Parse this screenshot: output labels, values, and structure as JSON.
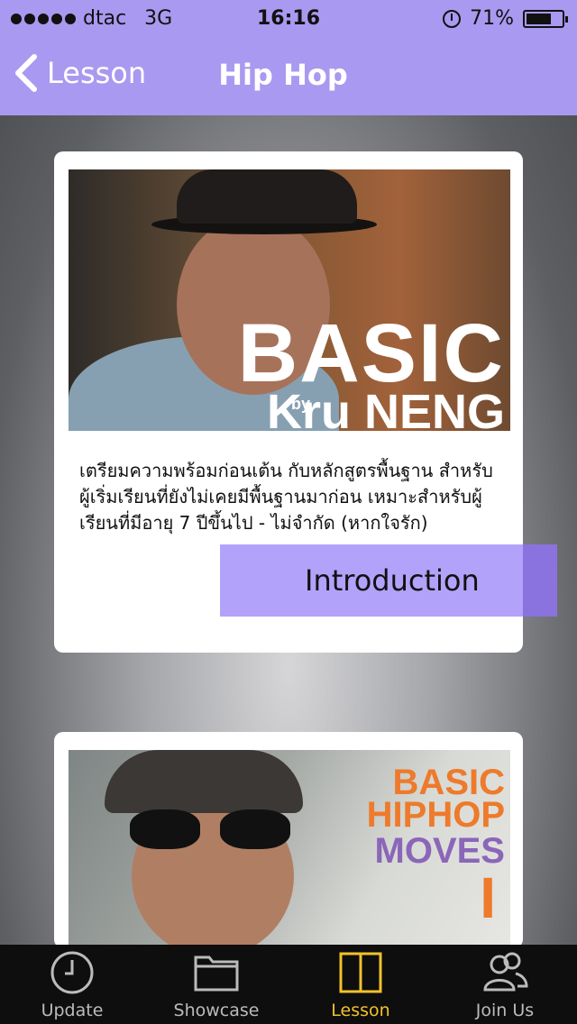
{
  "status_bar": {
    "carrier": "dtac",
    "network": "3G",
    "time": "16:16",
    "battery": "71%",
    "battery_level": 0.71
  },
  "nav": {
    "back_label": "Lesson",
    "title": "Hip Hop"
  },
  "lessons": [
    {
      "title_line1": "BASIC",
      "by": "by",
      "title_line2": "Kru NENG",
      "description": "เตรียมความพร้อมก่อนเต้น กับหลักสูตรพื้นฐาน สำหรับผู้เริ่มเรียนที่ยังไม่เคยมีพื้นฐานมาก่อน เหมาะสำหรับผู้เรียนที่มีอายุ 7 ปีขึ้นไป - ไม่จำกัด (หากใจรัก)",
      "button_label": "Introduction"
    },
    {
      "line1": "BASIC",
      "line2": "HIPHOP",
      "line3": "MOVES",
      "line4": "I"
    }
  ],
  "tabs": [
    {
      "label": "Update",
      "icon": "clock-icon"
    },
    {
      "label": "Showcase",
      "icon": "folder-icon"
    },
    {
      "label": "Lesson",
      "icon": "book-icon"
    },
    {
      "label": "Join Us",
      "icon": "people-icon"
    }
  ],
  "colors": {
    "accent": "#a999f0",
    "button": "#b2a2fa",
    "active_tab": "#f1c22a",
    "orange_title": "#ee7a2b",
    "purple_title": "#8b66b8"
  }
}
